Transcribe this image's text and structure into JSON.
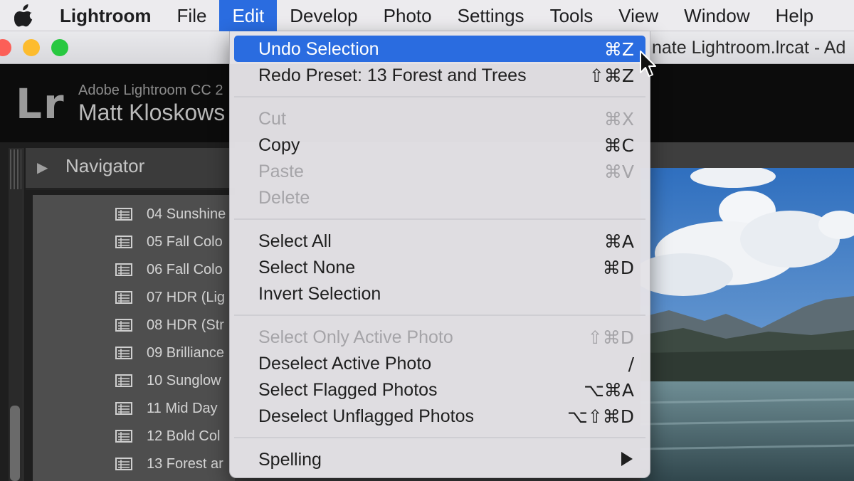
{
  "menubar": {
    "app": "Lightroom",
    "items": [
      "File",
      "Edit",
      "Develop",
      "Photo",
      "Settings",
      "Tools",
      "View",
      "Window",
      "Help"
    ]
  },
  "window": {
    "title": "nate Lightroom.lrcat - Ad"
  },
  "identity": {
    "logo": "Lr",
    "product": "Adobe Lightroom CC 2",
    "user": "Matt Kloskows"
  },
  "navigator": {
    "label": "Navigator"
  },
  "presets": [
    "04 Sunshine",
    "05 Fall Colo",
    "06 Fall Colo",
    "07 HDR (Lig",
    "08 HDR (Str",
    "09 Brilliance",
    "10 Sunglow",
    "11 Mid Day",
    "12 Bold Col",
    "13 Forest ar"
  ],
  "edit_menu": {
    "undo": {
      "label": "Undo Selection",
      "shortcut": "⌘Z"
    },
    "redo": {
      "label": "Redo Preset: 13 Forest and Trees",
      "shortcut": "⇧⌘Z"
    },
    "cut": {
      "label": "Cut",
      "shortcut": "⌘X"
    },
    "copy": {
      "label": "Copy",
      "shortcut": "⌘C"
    },
    "paste": {
      "label": "Paste",
      "shortcut": "⌘V"
    },
    "delete": {
      "label": "Delete"
    },
    "select_all": {
      "label": "Select All",
      "shortcut": "⌘A"
    },
    "select_none": {
      "label": "Select None",
      "shortcut": "⌘D"
    },
    "invert_selection": {
      "label": "Invert Selection"
    },
    "select_only_active": {
      "label": "Select Only Active Photo",
      "shortcut": "⇧⌘D"
    },
    "deselect_active": {
      "label": "Deselect Active Photo",
      "shortcut": "/"
    },
    "select_flagged": {
      "label": "Select Flagged Photos",
      "shortcut": "⌥⌘A"
    },
    "deselect_unflagged": {
      "label": "Deselect Unflagged Photos",
      "shortcut": "⌥⇧⌘D"
    },
    "spelling": {
      "label": "Spelling"
    }
  },
  "colors": {
    "highlight": "#2a6ce0",
    "menubar": "#ecebee"
  }
}
